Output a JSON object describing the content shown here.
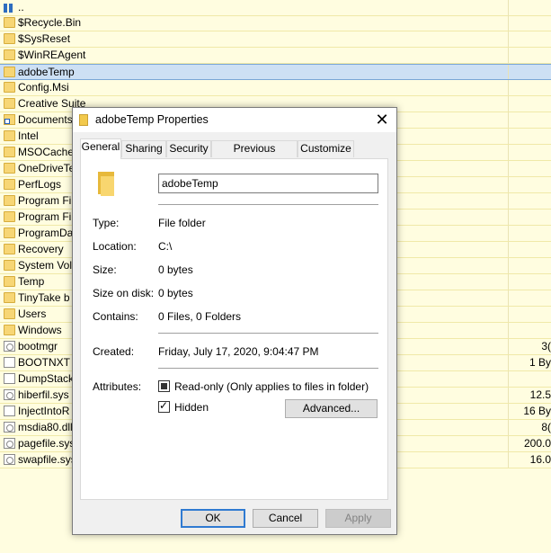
{
  "file_list": [
    {
      "name": "..",
      "icon": "up-icon",
      "size": ""
    },
    {
      "name": "$Recycle.Bin",
      "icon": "folder-icon",
      "size": ""
    },
    {
      "name": "$SysReset",
      "icon": "folder-icon",
      "size": ""
    },
    {
      "name": "$WinREAgent",
      "icon": "folder-icon",
      "size": ""
    },
    {
      "name": "adobeTemp",
      "icon": "folder-icon",
      "size": "",
      "selected": true
    },
    {
      "name": "Config.Msi",
      "icon": "folder-icon",
      "size": ""
    },
    {
      "name": "Creative Suite",
      "icon": "folder-icon",
      "size": ""
    },
    {
      "name": "Documents",
      "icon": "shortcut-folder-icon",
      "size": ""
    },
    {
      "name": "Intel",
      "icon": "folder-icon",
      "size": ""
    },
    {
      "name": "MSOCache",
      "icon": "folder-icon",
      "size": ""
    },
    {
      "name": "OneDriveTe",
      "icon": "folder-icon",
      "size": ""
    },
    {
      "name": "PerfLogs",
      "icon": "folder-icon",
      "size": ""
    },
    {
      "name": "Program Fil",
      "icon": "folder-icon",
      "size": ""
    },
    {
      "name": "Program Fil",
      "icon": "folder-icon",
      "size": ""
    },
    {
      "name": "ProgramDat",
      "icon": "folder-icon",
      "size": ""
    },
    {
      "name": "Recovery",
      "icon": "folder-icon",
      "size": ""
    },
    {
      "name": "System Vol",
      "icon": "folder-icon",
      "size": ""
    },
    {
      "name": "Temp",
      "icon": "folder-icon",
      "size": ""
    },
    {
      "name": "TinyTake b",
      "icon": "folder-icon",
      "size": ""
    },
    {
      "name": "Users",
      "icon": "folder-icon",
      "size": ""
    },
    {
      "name": "Windows",
      "icon": "folder-icon",
      "size": ""
    },
    {
      "name": "bootmgr",
      "icon": "system-file-icon",
      "size": "3("
    },
    {
      "name": "BOOTNXT",
      "icon": "file-icon",
      "size": "1 By"
    },
    {
      "name": "DumpStack",
      "icon": "file-icon",
      "size": ""
    },
    {
      "name": "hiberfil.sys",
      "icon": "system-file-icon",
      "size": "12.5"
    },
    {
      "name": "InjectIntoR",
      "icon": "file-icon",
      "size": "16 By"
    },
    {
      "name": "msdia80.dll",
      "icon": "system-file-icon",
      "size": "8("
    },
    {
      "name": "pagefile.sys",
      "icon": "system-file-icon",
      "size": "200.0"
    },
    {
      "name": "swapfile.sys",
      "icon": "system-file-icon",
      "size": "16.0"
    }
  ],
  "dialog": {
    "title": "adobeTemp Properties",
    "close_label": "✕",
    "tabs": [
      "General",
      "Sharing",
      "Security",
      "Previous Versions",
      "Customize"
    ],
    "active_tab": "General",
    "name_value": "adobeTemp",
    "properties": [
      {
        "label": "Type:",
        "value": "File folder"
      },
      {
        "label": "Location:",
        "value": "C:\\"
      },
      {
        "label": "Size:",
        "value": "0 bytes"
      },
      {
        "label": "Size on disk:",
        "value": "0 bytes"
      },
      {
        "label": "Contains:",
        "value": "0 Files, 0 Folders"
      }
    ],
    "created_label": "Created:",
    "created_value": "Friday, July 17, 2020, 9:04:47 PM",
    "attributes_label": "Attributes:",
    "readonly_label": "Read-only (Only applies to files in folder)",
    "readonly_state": "indeterminate",
    "hidden_label": "Hidden",
    "hidden_checked": true,
    "advanced_label": "Advanced...",
    "ok_label": "OK",
    "cancel_label": "Cancel",
    "apply_label": "Apply"
  }
}
